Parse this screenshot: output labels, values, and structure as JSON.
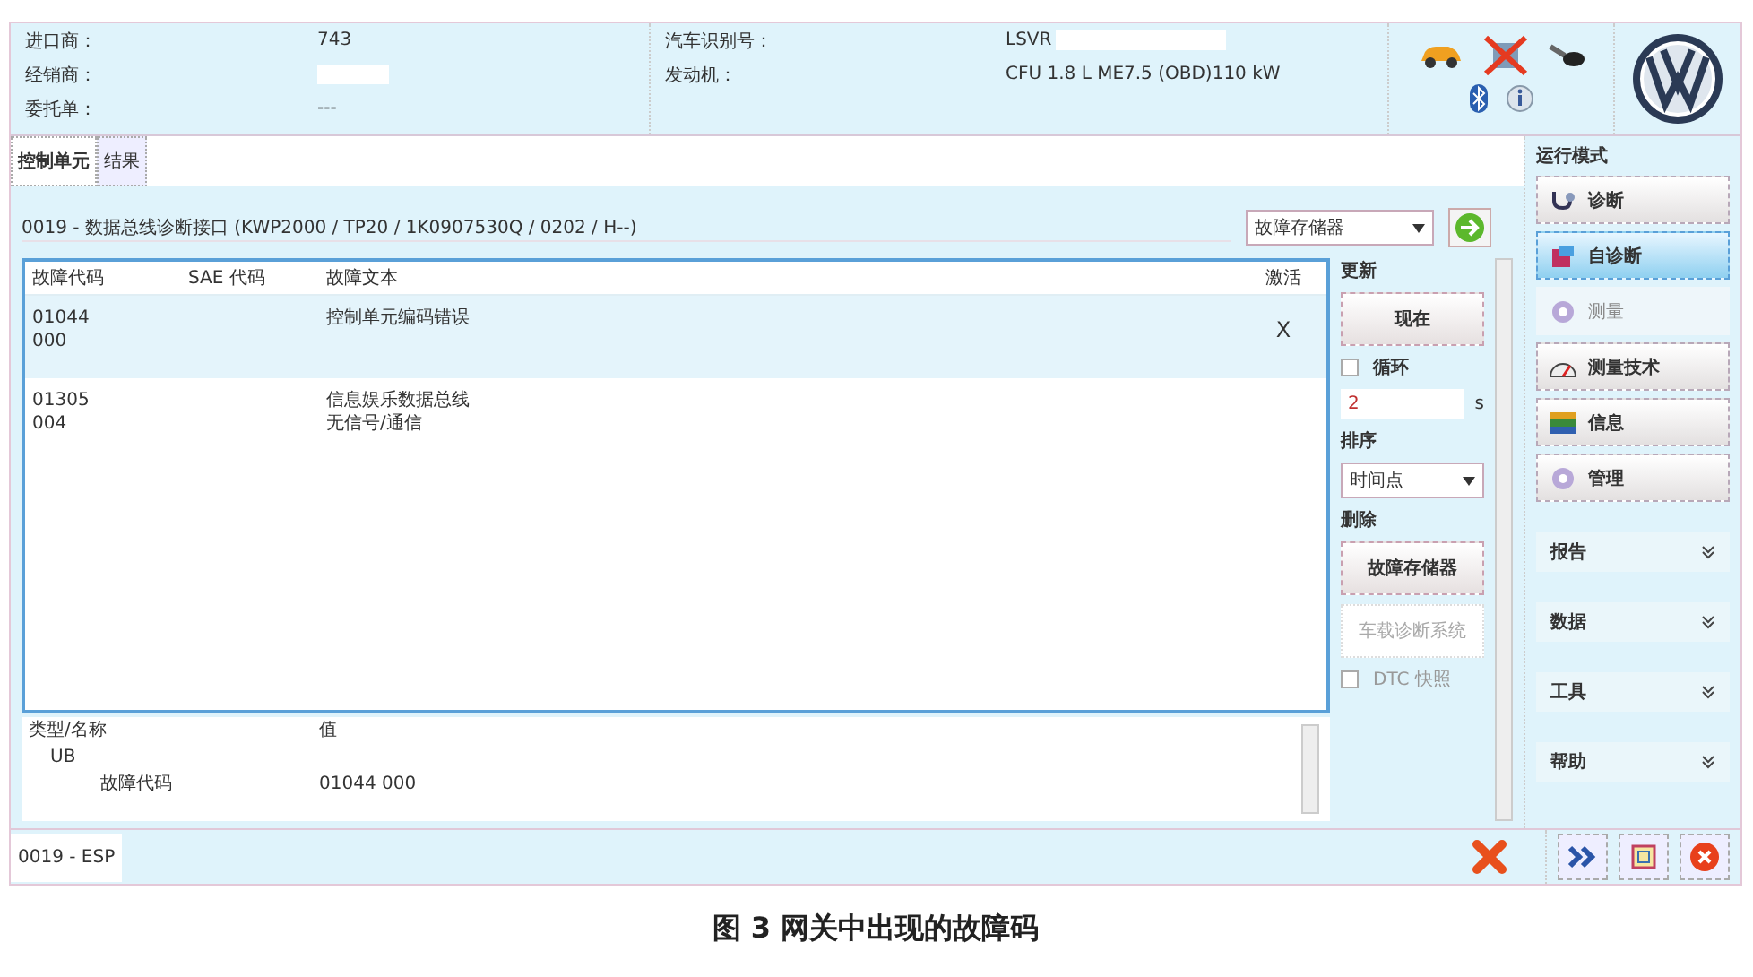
{
  "header": {
    "left": [
      {
        "label": "进口商：",
        "value": "743",
        "redacted": false
      },
      {
        "label": "经销商：",
        "redacted": true
      },
      {
        "label": "委托单：",
        "value": "---",
        "redacted": false
      }
    ],
    "right": [
      {
        "label": "汽车识别号：",
        "value": "LSVR",
        "redacted": true
      },
      {
        "label": "发动机：",
        "value": "CFU 1.8 L ME7.5 (OBD)110 kW",
        "redacted": false
      }
    ]
  },
  "tabs": [
    {
      "label": "控制单元",
      "selected": true
    },
    {
      "label": "结果",
      "selected": false
    }
  ],
  "unit_title": "0019 - 数据总线诊断接口  (KWP2000 / TP20 / 1K0907530Q / 0202 / H--)",
  "memory_select": {
    "value": "故障存储器"
  },
  "fault_table": {
    "columns": [
      "故障代码",
      "SAE 代码",
      "故障文本",
      "激活"
    ],
    "rows": [
      {
        "code": "01044",
        "sub": "000",
        "sae": "",
        "text": [
          "控制单元编码错误"
        ],
        "active": "X",
        "selected": true
      },
      {
        "code": "01305",
        "sub": "004",
        "sae": "",
        "text": [
          "信息娱乐数据总线",
          "无信号/通信"
        ],
        "active": "",
        "selected": false
      }
    ]
  },
  "controls": {
    "update_label": "更新",
    "now_button": "现在",
    "loop": {
      "label": "循环",
      "checked": false
    },
    "interval": {
      "value": "2",
      "unit": "s"
    },
    "sort_label": "排序",
    "sort_select": "时间点",
    "delete_label": "删除",
    "delete_button": "故障存储器",
    "vehicle_button": {
      "label": "车载诊断系统",
      "disabled": true
    },
    "dtc": {
      "label": "DTC 快照",
      "checked": false,
      "disabled": true
    }
  },
  "detail_table": {
    "columns": [
      "类型/名称",
      "值"
    ],
    "rows": [
      {
        "name": "UB",
        "value": "",
        "children": [
          {
            "name": "故障代码",
            "value": "01044 000"
          }
        ]
      }
    ]
  },
  "status_bar": {
    "text": "0019 - ESP"
  },
  "sidebar": {
    "mode_header": "运行模式",
    "items": [
      {
        "label": "诊断",
        "selected": false,
        "disabled": false,
        "kind": "stethoscope"
      },
      {
        "label": "自诊断",
        "selected": true,
        "disabled": false,
        "kind": "car"
      },
      {
        "label": "测量",
        "selected": false,
        "disabled": true,
        "kind": "gear"
      },
      {
        "label": "测量技术",
        "selected": false,
        "disabled": false,
        "kind": "gauge"
      },
      {
        "label": "信息",
        "selected": false,
        "disabled": false,
        "kind": "books"
      },
      {
        "label": "管理",
        "selected": false,
        "disabled": false,
        "kind": "gear"
      }
    ],
    "sections": [
      {
        "label": "报告",
        "expanded": false
      },
      {
        "label": "数据",
        "expanded": false
      },
      {
        "label": "工具",
        "expanded": false
      },
      {
        "label": "帮助",
        "expanded": false
      }
    ]
  },
  "caption": "图 3  网关中出现的故障码"
}
